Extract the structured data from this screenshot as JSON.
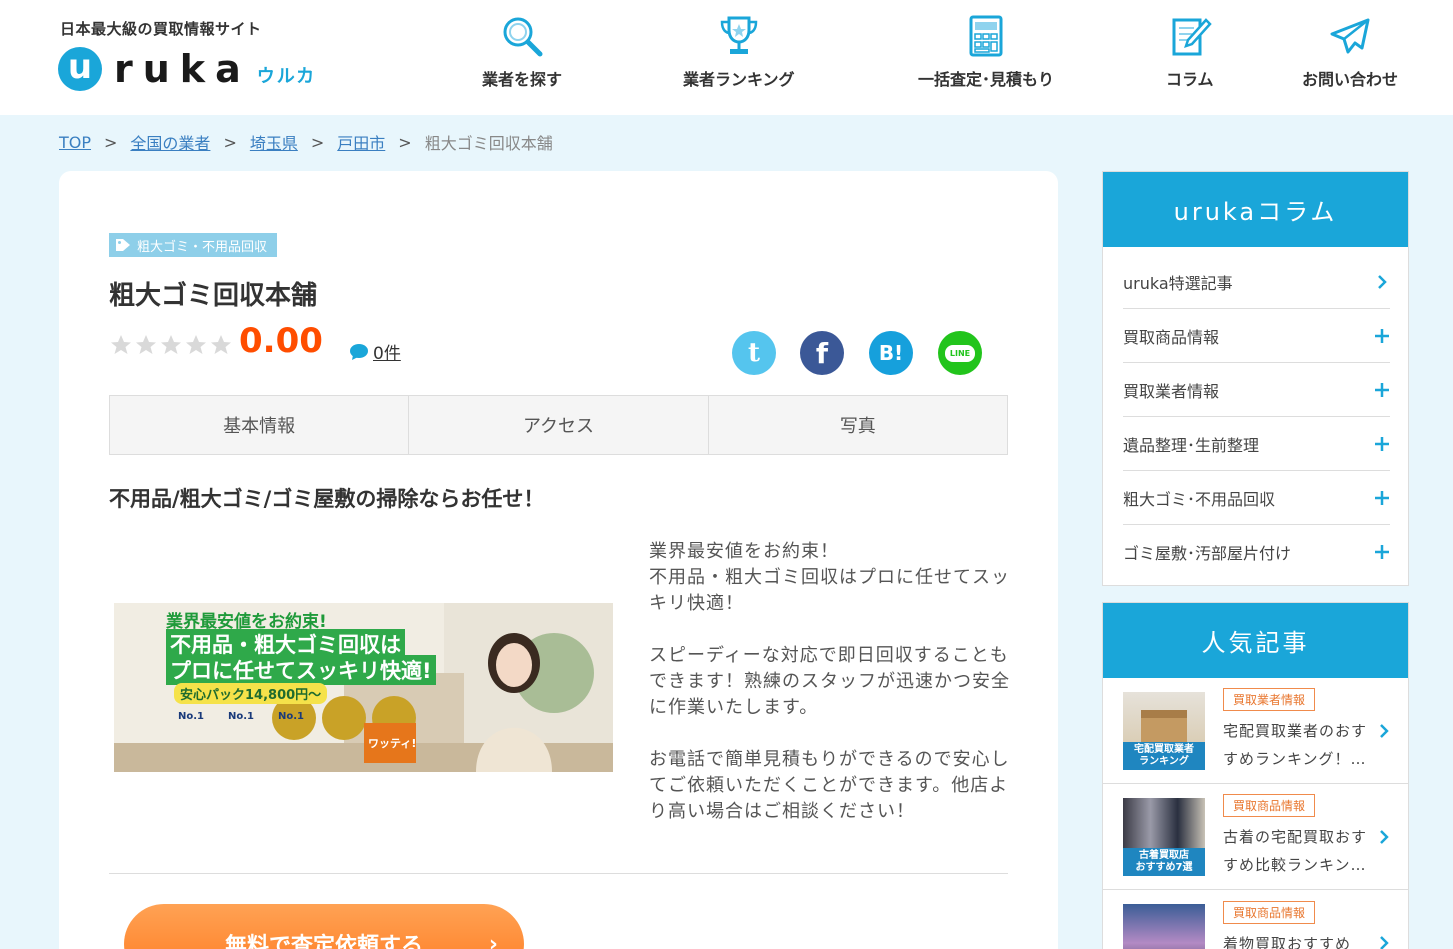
{
  "header": {
    "tagline": "日本最大級の買取情報サイト",
    "logo_u": "u",
    "logo_rest": "ruka",
    "logo_kana": "ウルカ",
    "nav": [
      {
        "label": "業者を探す",
        "icon": "magnifier-icon"
      },
      {
        "label": "業者ランキング",
        "icon": "trophy-icon"
      },
      {
        "label": "一括査定･見積もり",
        "icon": "calculator-icon"
      },
      {
        "label": "コラム",
        "icon": "pen-paper-icon"
      },
      {
        "label": "お問い合わせ",
        "icon": "paper-plane-icon"
      }
    ]
  },
  "breadcrumb": {
    "links": [
      "TOP",
      "全国の業者",
      "埼玉県",
      "戸田市"
    ],
    "separator": ">",
    "current": "粗大ゴミ回収本舗"
  },
  "main": {
    "tag": "粗大ゴミ・不用品回収",
    "title": "粗大ゴミ回収本舗",
    "rating": "0.00",
    "review_count": "0件",
    "share": {
      "twitter_glyph": "t",
      "facebook_glyph": "f",
      "hatena_glyph": "B!",
      "line_glyph": "LINE"
    },
    "tabs": [
      "基本情報",
      "アクセス",
      "写真"
    ],
    "subheading": "不用品/粗大ゴミ/ゴミ屋敷の掃除ならお任せ！",
    "banner": {
      "line1": "業界最安値をお約束!",
      "line2": "不用品・粗大ゴミ回収は",
      "line3": "プロに任せてスッキリ快適!",
      "price": "安心パック14,800円〜",
      "badge": "No.1",
      "tag": "ワッティ!"
    },
    "description": [
      "業界最安値をお約束！\n不用品・粗大ゴミ回収はプロに任せてスッキリ快適！",
      "スピーディーな対応で即日回収することもできます！熟練のスタッフが迅速かつ安全に作業いたします。",
      "お電話で簡単見積もりができるので安心してご依頼いただくことができます。他店より高い場合はご相談ください！"
    ],
    "cta": "無料で査定依頼する",
    "cta_arrow": "›"
  },
  "sidebar": {
    "column_title": "urukaコラム",
    "column_items": [
      {
        "label": "uruka特選記事",
        "sign": "chevron"
      },
      {
        "label": "買取商品情報",
        "sign": "plus"
      },
      {
        "label": "買取業者情報",
        "sign": "plus"
      },
      {
        "label": "遺品整理･生前整理",
        "sign": "plus"
      },
      {
        "label": "粗大ゴミ･不用品回収",
        "sign": "plus"
      },
      {
        "label": "ゴミ屋敷･汚部屋片付け",
        "sign": "plus"
      }
    ],
    "popular_title": "人気記事",
    "popular_items": [
      {
        "badge": "買取業者情報",
        "title": "宅配買取業者のおすすめランキング！…",
        "thumb_caption": "宅配買取業者\nランキング"
      },
      {
        "badge": "買取商品情報",
        "title": "古着の宅配買取おすすめ比較ランキン…",
        "thumb_caption": "古着買取店\nおすすめ7選"
      },
      {
        "badge": "買取商品情報",
        "title": "着物買取おすすめ比…",
        "thumb_caption": ""
      }
    ]
  },
  "colors": {
    "brand_blue": "#1aa6d9",
    "rating_orange": "#ff4d00",
    "cta_orange": "#ff8a33",
    "page_bg": "#e8f6fc"
  }
}
